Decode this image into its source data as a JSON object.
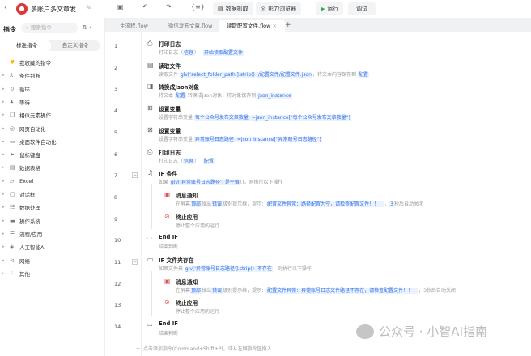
{
  "app": {
    "title": "多账户多文章发...",
    "toolbar": {
      "data_capture": "数据抓取",
      "browser": "影刀浏览器",
      "run": "运行",
      "debug": "调试"
    }
  },
  "sidebar": {
    "heading": "指令",
    "search_placeholder": "搜索指令",
    "tabs": [
      "标准指令",
      "自定义指令"
    ],
    "items": [
      {
        "label": "我收藏的指令",
        "icon": "heart-icon"
      },
      {
        "label": "条件判断",
        "icon": "branch-icon"
      },
      {
        "label": "循环",
        "icon": "loop-icon"
      },
      {
        "label": "等待",
        "icon": "hourglass-icon"
      },
      {
        "label": "相似元素操作",
        "icon": "copy-icon"
      },
      {
        "label": "网页自动化",
        "icon": "globe-icon"
      },
      {
        "label": "桌面软件自动化",
        "icon": "monitor-icon"
      },
      {
        "label": "鼠标键盘",
        "icon": "cursor-icon"
      },
      {
        "label": "数据表格",
        "icon": "table-icon"
      },
      {
        "label": "Excel",
        "icon": "folder-icon"
      },
      {
        "label": "对话框",
        "icon": "dialog-icon"
      },
      {
        "label": "数据处理",
        "icon": "data-icon"
      },
      {
        "label": "操作系统",
        "icon": "system-icon"
      },
      {
        "label": "流程/应用",
        "icon": "flow-icon"
      },
      {
        "label": "人工智能AI",
        "icon": "ai-icon"
      },
      {
        "label": "网络",
        "icon": "network-icon"
      },
      {
        "label": "其他",
        "icon": "grid-icon"
      }
    ]
  },
  "tabs": [
    "主流程.flow",
    "微信发布文章.flow",
    "读取配置文件.flow"
  ],
  "steps": [
    {
      "n": "1",
      "title": "打印日志",
      "desc": [
        {
          "t": "打印日志（"
        },
        {
          "t": "信息",
          "h": 1
        },
        {
          "t": "）： "
        },
        {
          "t": "开始读取配置文件",
          "h": 1
        }
      ]
    },
    {
      "n": "2",
      "title": "读取文件",
      "desc": [
        {
          "t": "读取文件 "
        },
        {
          "t": "glv['select_folder_path'].strip()",
          "h": 1
        },
        {
          "t": " /配置文件/配置文件.json",
          "h": 1
        },
        {
          "t": "，将文本内容保存到 "
        },
        {
          "t": "配置",
          "h": 1
        }
      ]
    },
    {
      "n": "3",
      "title": "转换成Json对象",
      "desc": [
        {
          "t": "将文本 "
        },
        {
          "t": "配置",
          "h": 1
        },
        {
          "t": " 转换成Json对象，将对象保存到 "
        },
        {
          "t": "json_instance",
          "h": 1
        }
      ]
    },
    {
      "n": "4",
      "title": "设置变量",
      "desc": [
        {
          "t": "设置字符串变量 "
        },
        {
          "t": "每个公众号发布文章数量",
          "h": 1
        },
        {
          "t": " =json_instance[\"每个公众号发布文章数量\"]",
          "h": 1
        }
      ]
    },
    {
      "n": "5",
      "title": "设置变量",
      "desc": [
        {
          "t": "设置字符串变量 "
        },
        {
          "t": "异常账号日志路径",
          "h": 1
        },
        {
          "t": " =json_instance[\"异常账号日志路径\"]",
          "h": 1
        }
      ]
    },
    {
      "n": "6",
      "title": "打印日志",
      "desc": [
        {
          "t": "打印日志（"
        },
        {
          "t": "信息",
          "h": 1
        },
        {
          "t": "）： "
        },
        {
          "t": "配置",
          "h": 1
        }
      ]
    },
    {
      "n": "7",
      "title": "IF 条件",
      "desc": [
        {
          "t": "如果 "
        },
        {
          "t": "glv['异常账号日志路径'] 是空值",
          "h": 1
        },
        {
          "t": "()，则执行以下操作"
        }
      ]
    },
    {
      "n": "8",
      "title": "消息通知",
      "desc": [
        {
          "t": "在屏幕"
        },
        {
          "t": "顶部",
          "h": 1
        },
        {
          "t": "弹出"
        },
        {
          "t": "错误",
          "h": 1
        },
        {
          "t": "级别提示框，提示："
        },
        {
          "t": "配置文件异常：路径配置为空，请检查配置文件！！！",
          "h": 1
        },
        {
          "t": "，"
        },
        {
          "t": "3",
          "h": 1
        },
        {
          "t": "秒后自动关闭"
        }
      ]
    },
    {
      "n": "9",
      "title": "终止应用",
      "desc": [
        {
          "t": "停止整个应用的运行"
        }
      ]
    },
    {
      "n": "10",
      "title": "End IF",
      "desc": [
        {
          "t": "结束判断"
        }
      ]
    },
    {
      "n": "11",
      "title": "IF 文件夹存在",
      "desc": [
        {
          "t": "如果文件夹 "
        },
        {
          "t": "glv['异常账号日志路径'].strip()",
          "h": 1
        },
        {
          "t": " 不存在",
          "h": 1
        },
        {
          "t": "，则执行以下操作"
        }
      ]
    },
    {
      "n": "12",
      "title": "消息通知",
      "desc": [
        {
          "t": "在屏幕"
        },
        {
          "t": "顶部",
          "h": 1
        },
        {
          "t": "弹出"
        },
        {
          "t": "错误",
          "h": 1
        },
        {
          "t": "级别提示框，提示："
        },
        {
          "t": "配置文件异常：异常账号日志文件路径不存在，请检查配置文件！！！",
          "h": 1
        },
        {
          "t": "，3秒后自动关闭"
        }
      ]
    },
    {
      "n": "13",
      "title": "终止应用",
      "desc": [
        {
          "t": "停止整个应用的运行"
        }
      ]
    },
    {
      "n": "14",
      "title": "End IF",
      "desc": [
        {
          "t": "结束判断"
        }
      ]
    }
  ],
  "add_hint": "点击添加指令(Command+Shift+P)，或从左侧指令区拖入",
  "watermark": "公众号 · 小智AI指南"
}
